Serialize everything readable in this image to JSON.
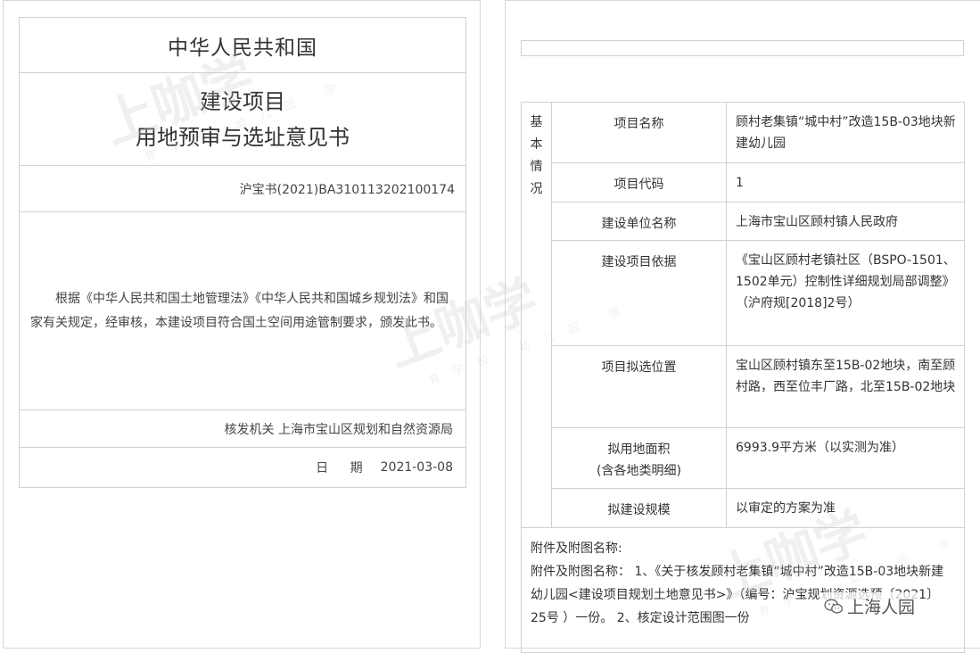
{
  "left": {
    "country": "中华人民共和国",
    "title_line1": "建设项目",
    "title_line2": "用地预审与选址意见书",
    "cert_number": "沪宝书(2021)BA310113202100174",
    "body_text": "根据《中华人民共和国土地管理法》《中华人民共和国城乡规划法》和国家有关规定，经审核，本建设项目符合国土空间用途管制要求，颁发此书。",
    "issuer": "核发机关 上海市宝山区规划和自然资源局",
    "date_label": "日 期",
    "date_value": "2021-03-08"
  },
  "right": {
    "section_label": [
      "基",
      "本",
      "情",
      "况"
    ],
    "rows": [
      {
        "label": "项目名称",
        "value": "顾村老集镇“城中村”改造15B-03地块新建幼儿园"
      },
      {
        "label": "项目代码",
        "value": "1"
      },
      {
        "label": "建设单位名称",
        "value": "上海市宝山区顾村镇人民政府"
      },
      {
        "label": "建设项目依据",
        "value": "《宝山区顾村老镇社区（BSPO-1501、1502单元）控制性详细规划局部调整》（沪府规[2018]2号）"
      },
      {
        "label": "项目拟选位置",
        "value": "宝山区顾村镇东至15B-02地块，南至顾村路，西至位丰厂路，北至15B-02地块"
      },
      {
        "label": "拟用地面积",
        "label2": "(含各地类明细)",
        "value": "6993.9平方米（以实测为准）"
      },
      {
        "label": "拟建设规模",
        "value": "以审定的方案为准"
      }
    ],
    "attachment_title": "附件及附图名称:",
    "attachment_text": "附件及附图名称： 1、《关于核发顾村老集镇“城中村”改造15B-03地块新建幼儿园<建设项目规划土地意见书>》（编号：沪宝规划资源选预〔2021〕25号 ）一份。 2、核定设计范围图一份"
  },
  "watermark": {
    "text": "上咖学",
    "subtext": "育 学 校 · 幼 儿 园 · 学"
  },
  "badge": {
    "text": "上海人园",
    "icon": "wechat-icon"
  }
}
